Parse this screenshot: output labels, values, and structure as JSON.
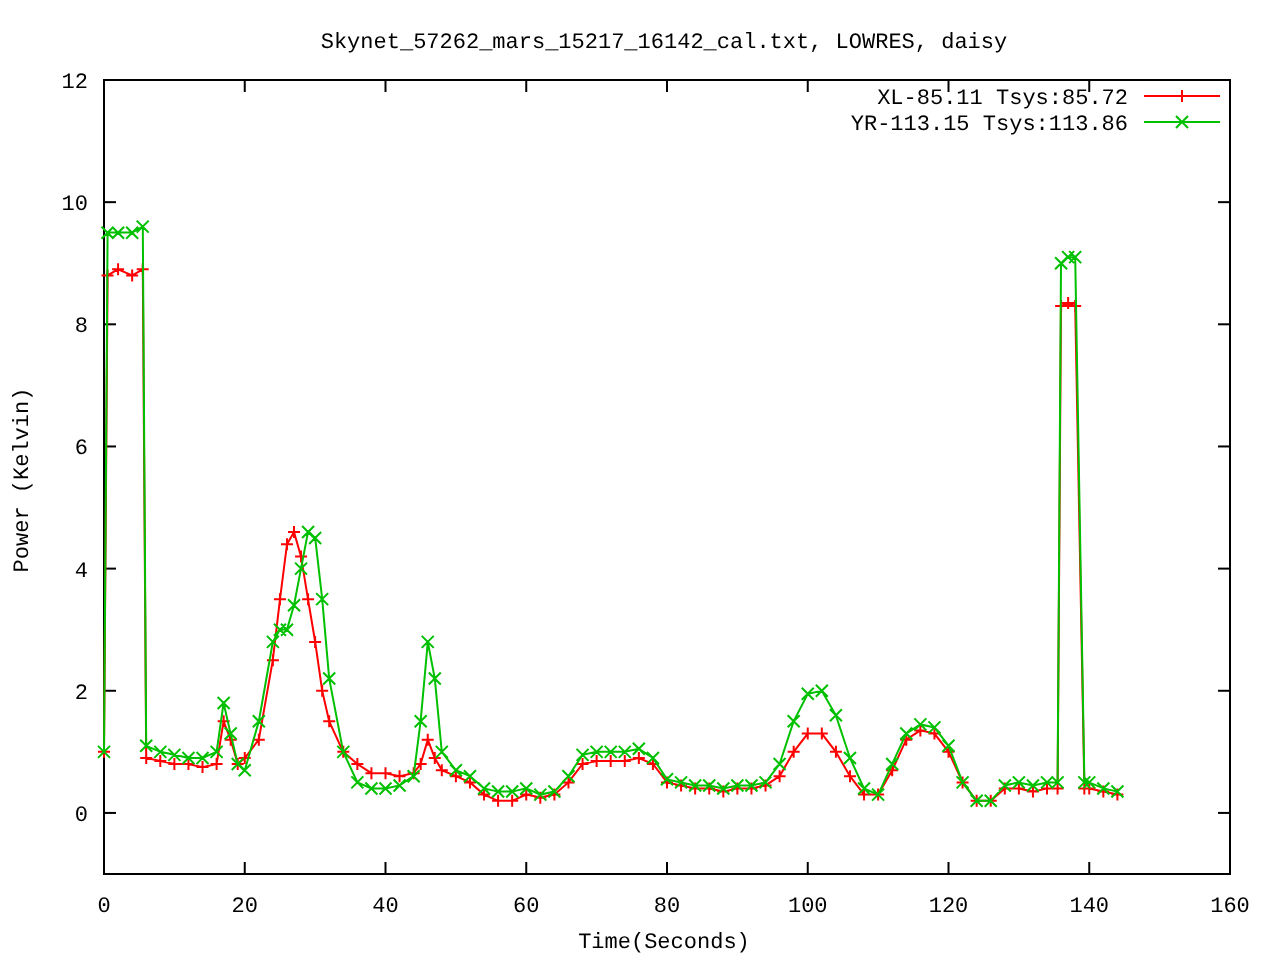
{
  "chart": {
    "chart_data": {
      "type": "line",
      "title": "Skynet_57262_mars_15217_16142_cal.txt, LOWRES, daisy",
      "xlabel": "Time(Seconds)",
      "ylabel": "Power (Kelvin)",
      "x": [
        0,
        0.5,
        2,
        4,
        5.5,
        6,
        8,
        10,
        12,
        14,
        16,
        17,
        18,
        19,
        20,
        22,
        24,
        25,
        26,
        27,
        28,
        29,
        30,
        31,
        32,
        34,
        36,
        38,
        40,
        42,
        44,
        45,
        46,
        47,
        48,
        50,
        52,
        54,
        56,
        58,
        60,
        62,
        64,
        66,
        68,
        70,
        72,
        74,
        76,
        78,
        80,
        82,
        84,
        86,
        88,
        90,
        92,
        94,
        96,
        98,
        100,
        102,
        104,
        106,
        108,
        110,
        112,
        114,
        116,
        118,
        120,
        122,
        124,
        126,
        128,
        130,
        132,
        134,
        135.5,
        136,
        137,
        138,
        139.3,
        140,
        142,
        144
      ],
      "series": [
        {
          "name": "XL-85.11 Tsys:85.72",
          "color": "#ff0000",
          "marker": "plus",
          "values": [
            1.0,
            8.8,
            8.9,
            8.8,
            8.9,
            0.9,
            0.85,
            0.8,
            0.8,
            0.75,
            0.8,
            1.5,
            1.2,
            0.8,
            0.9,
            1.2,
            2.5,
            3.5,
            4.4,
            4.6,
            4.2,
            3.5,
            2.8,
            2.0,
            1.5,
            1.0,
            0.8,
            0.65,
            0.65,
            0.6,
            0.65,
            0.8,
            1.2,
            0.9,
            0.7,
            0.6,
            0.5,
            0.3,
            0.2,
            0.2,
            0.3,
            0.25,
            0.3,
            0.5,
            0.8,
            0.85,
            0.85,
            0.85,
            0.9,
            0.8,
            0.5,
            0.45,
            0.4,
            0.4,
            0.35,
            0.4,
            0.4,
            0.45,
            0.6,
            1.0,
            1.3,
            1.3,
            1.0,
            0.6,
            0.3,
            0.3,
            0.7,
            1.2,
            1.35,
            1.3,
            1.0,
            0.5,
            0.2,
            0.2,
            0.4,
            0.4,
            0.35,
            0.4,
            0.4,
            8.3,
            8.35,
            8.3,
            0.4,
            0.4,
            0.35,
            0.3
          ]
        },
        {
          "name": "YR-113.15 Tsys:113.86",
          "color": "#00c000",
          "marker": "cross",
          "values": [
            1.0,
            9.5,
            9.5,
            9.5,
            9.6,
            1.1,
            1.0,
            0.95,
            0.9,
            0.9,
            1.0,
            1.8,
            1.3,
            0.8,
            0.7,
            1.5,
            2.8,
            3.0,
            3.0,
            3.4,
            4.0,
            4.6,
            4.5,
            3.5,
            2.2,
            1.0,
            0.5,
            0.4,
            0.4,
            0.45,
            0.6,
            1.5,
            2.8,
            2.2,
            1.0,
            0.7,
            0.6,
            0.4,
            0.35,
            0.35,
            0.4,
            0.3,
            0.35,
            0.6,
            0.95,
            1.0,
            1.0,
            1.0,
            1.05,
            0.9,
            0.55,
            0.5,
            0.45,
            0.45,
            0.4,
            0.45,
            0.45,
            0.5,
            0.8,
            1.5,
            1.95,
            2.0,
            1.6,
            0.9,
            0.4,
            0.3,
            0.8,
            1.3,
            1.45,
            1.4,
            1.1,
            0.5,
            0.2,
            0.2,
            0.45,
            0.5,
            0.45,
            0.5,
            0.5,
            9.0,
            9.1,
            9.1,
            0.5,
            0.5,
            0.4,
            0.35
          ]
        }
      ],
      "legend": true,
      "xlim": [
        0,
        160
      ],
      "ylim": [
        -1,
        12
      ],
      "xticks": [
        0,
        20,
        40,
        60,
        80,
        100,
        120,
        140,
        160
      ],
      "yticks": [
        0,
        2,
        4,
        6,
        8,
        10,
        12
      ]
    }
  }
}
